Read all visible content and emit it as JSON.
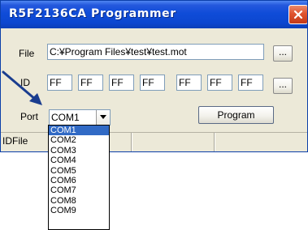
{
  "window": {
    "title": "R5F2136CA Programmer"
  },
  "file_row": {
    "label": "File",
    "path_value": "C:¥Program Files¥test¥test.mot",
    "browse_label": "..."
  },
  "id_row": {
    "label": "ID",
    "fields": [
      "FF",
      "FF",
      "FF",
      "FF",
      "FF",
      "FF",
      "FF"
    ],
    "browse_label": "..."
  },
  "port_row": {
    "label": "Port",
    "selected": "COM1",
    "options": [
      "COM1",
      "COM2",
      "COM3",
      "COM4",
      "COM5",
      "COM6",
      "COM7",
      "COM8",
      "COM9"
    ]
  },
  "program_button": {
    "label": "Program"
  },
  "status_bar": {
    "text": "IDFile"
  },
  "colors": {
    "title_bar": "#0c47d0",
    "selection": "#316ac5",
    "annotation_arrow": "#1a3d8f"
  },
  "icons": {
    "close": "close-icon",
    "combo_arrow": "chevron-down-icon"
  }
}
